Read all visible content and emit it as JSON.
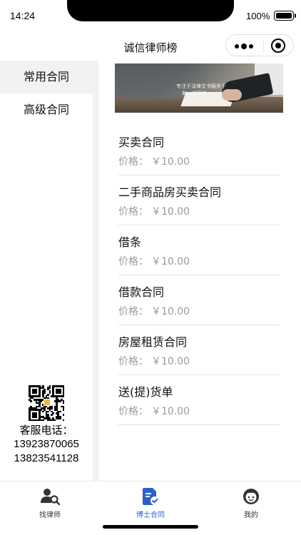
{
  "status_bar": {
    "time": "14:24",
    "battery_percent": "100%",
    "battery_level": 1.0
  },
  "nav": {
    "title": "诚信律师榜"
  },
  "sidebar": {
    "categories": [
      {
        "label": "常用合同",
        "active": true
      },
      {
        "label": "高级合同",
        "active": false
      }
    ]
  },
  "contact": {
    "label": "客服电话：",
    "phones": [
      "13923870065",
      "13823541128"
    ]
  },
  "banner": {
    "line1": "专注于法律文书服务于",
    "line2": "每一位客户"
  },
  "contracts": [
    {
      "title": "买卖合同",
      "price_label": "价格：",
      "price": "￥10.00"
    },
    {
      "title": "二手商品房买卖合同",
      "price_label": "价格：",
      "price": "￥10.00"
    },
    {
      "title": "借条",
      "price_label": "价格：",
      "price": "￥10.00"
    },
    {
      "title": "借款合同",
      "price_label": "价格：",
      "price": "￥10.00"
    },
    {
      "title": "房屋租赁合同",
      "price_label": "价格：",
      "price": "￥10.00"
    },
    {
      "title": "送(提)货单",
      "price_label": "价格：",
      "price": "￥10.00"
    }
  ],
  "tabbar": {
    "tabs": [
      {
        "label": "找律师",
        "icon": "find-lawyer-icon",
        "active": false
      },
      {
        "label": "博士合同",
        "icon": "contract-icon",
        "active": true
      },
      {
        "label": "我的",
        "icon": "profile-icon",
        "active": false
      }
    ]
  },
  "colors": {
    "accent": "#2a5fc9",
    "sidebar_active_bg": "#f2f2f2",
    "price_text": "#9a9a9a"
  }
}
